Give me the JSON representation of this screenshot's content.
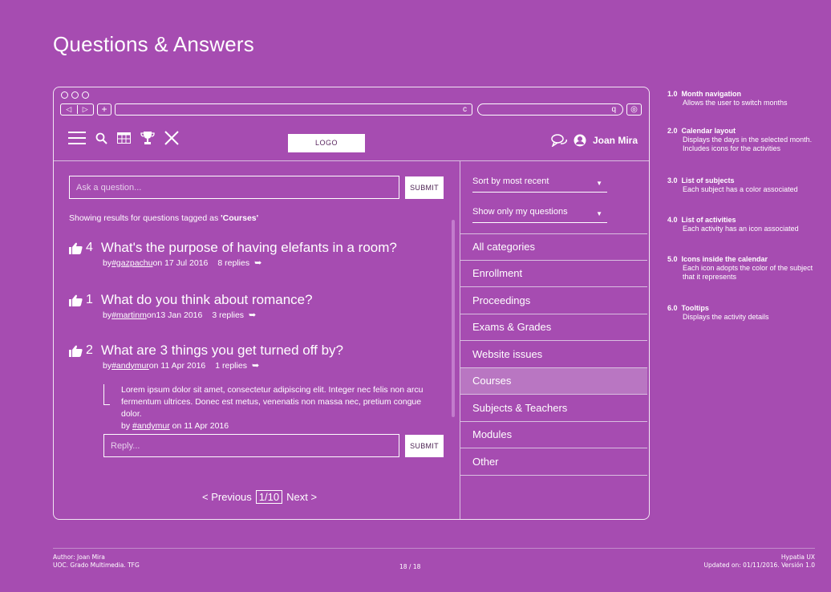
{
  "page": {
    "title": "Questions & Answers"
  },
  "browser": {
    "nav_back": "◁",
    "nav_forward": "▷",
    "new_tab": "+",
    "reload": "c",
    "search_icon": "q",
    "settings": "◎"
  },
  "toolbar": {
    "icons": [
      "menu-icon",
      "search-icon",
      "calendar-grid-icon",
      "trophy-icon",
      "close-icon"
    ],
    "logo": "LOGO",
    "user_name": "Joan Mira"
  },
  "ask": {
    "placeholder": "Ask a question...",
    "submit_label": "SUBMIT"
  },
  "results": {
    "prefix": "Showing results for questions tagged as ",
    "tag": "'Courses'"
  },
  "questions": [
    {
      "votes": "4",
      "title": "What's the purpose of having elefants in a room?",
      "by": "by ",
      "author": "#gazpachu",
      "date": " on 17 Jul 2016",
      "replies": "8 replies"
    },
    {
      "votes": "1",
      "title": "What do you think about romance?",
      "by": "by ",
      "author": "#martinm",
      "date": " on13 Jan 2016",
      "replies": "3 replies"
    },
    {
      "votes": "2",
      "title": "What are 3 things you get turned off by?",
      "by": "by ",
      "author": "#andymur",
      "date": " on 11 Apr 2016",
      "replies": "1 replies"
    }
  ],
  "reply": {
    "text": "Lorem ipsum dolor sit amet, consectetur adipiscing elit. Integer nec felis non arcu fermentum ultrices. Donec est metus, venenatis non massa nec, pretium congue dolor.",
    "by": "by ",
    "author": "#andymur",
    "date": " on 11 Apr 2016",
    "placeholder": "Reply...",
    "submit_label": "SUBMIT"
  },
  "pagination": {
    "previous": "< Previous",
    "current": "1/10",
    "next": "Next >"
  },
  "filters": {
    "sort_label": "Sort by most recent",
    "show_label": "Show only my questions"
  },
  "categories": [
    "All categories",
    "Enrollment",
    "Proceedings",
    "Exams & Grades",
    "Website issues",
    "Courses",
    "Subjects & Teachers",
    "Modules",
    "Other"
  ],
  "active_category": "Courses",
  "annotations": [
    {
      "num": "1.0",
      "title": "Month navigation",
      "desc": "Allows the user to switch months"
    },
    {
      "num": "2.0",
      "title": "Calendar layout",
      "desc": "Displays the days in the selected month. Includes icons for the activities"
    },
    {
      "num": "3.0",
      "title": "List of subjects",
      "desc": "Each subject has a color associated"
    },
    {
      "num": "4.0",
      "title": "List of activities",
      "desc": "Each activity has an icon associated"
    },
    {
      "num": "5.0",
      "title": "Icons inside the calendar",
      "desc": "Each icon adopts the color of the subject that it represents"
    },
    {
      "num": "6.0",
      "title": "Tooltips",
      "desc": "Displays the activity details"
    }
  ],
  "footer": {
    "author": "Author: Joan Mira",
    "org": "UOC. Grado Multimedia. TFG",
    "page": "18 / 18",
    "brand": "Hypatia UX",
    "updated": "Updated on: 01/11/2016. Versión 1.0"
  },
  "colors": {
    "background": "#a64cb1",
    "active_category": "#b976c2",
    "foreground": "#ffffff"
  }
}
